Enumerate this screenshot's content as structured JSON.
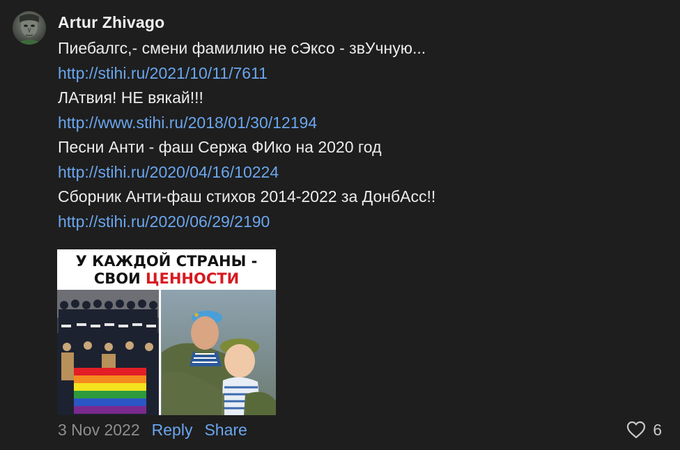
{
  "comment": {
    "author": "Artur Zhivago",
    "avatar_icon": "user-avatar-photo",
    "lines": [
      {
        "text": "Пиебалгс,- смени фамилию не сЭксо - звУчную...",
        "is_link": false
      },
      {
        "text": "http://stihi.ru/2021/10/11/7611",
        "is_link": true
      },
      {
        "text": "ЛАтвия! НЕ вякай!!!",
        "is_link": false
      },
      {
        "text": "http://www.stihi.ru/2018/01/30/12194",
        "is_link": true
      },
      {
        "text": "Песни Анти - фаш Сержа ФИко на 2020 год",
        "is_link": false
      },
      {
        "text": "http://stihi.ru/2020/04/16/10224",
        "is_link": true
      },
      {
        "text": "Сборник Анти-фаш стихов 2014-2022 за ДонбАсс!!",
        "is_link": false
      },
      {
        "text": "http://stihi.ru/2020/06/29/2190",
        "is_link": true
      }
    ],
    "attachment": {
      "title_line1": "У КАЖДОЙ СТРАНЫ -",
      "title_line2_prefix": "СВОИ ",
      "title_line2_highlight": "ЦЕННОСТИ"
    },
    "footer": {
      "date": "3 Nov 2022",
      "reply_label": "Reply",
      "share_label": "Share",
      "like_icon": "heart-icon",
      "like_count": "6"
    }
  },
  "colors": {
    "background": "#1e1e1e",
    "text": "#ececec",
    "link": "#6aa6ee",
    "muted": "#8e8e8e",
    "highlight_red": "#d71920"
  }
}
